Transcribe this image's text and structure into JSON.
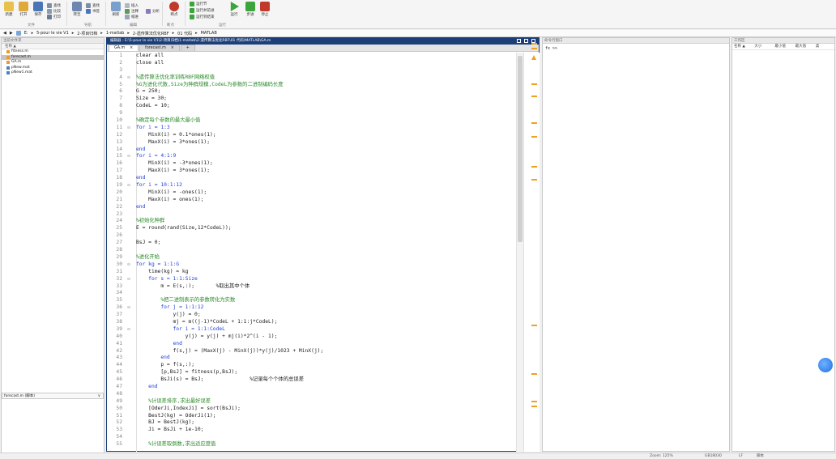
{
  "ribbon": {
    "buttons": [
      {
        "label": "新建",
        "color": "#e8c14a"
      },
      {
        "label": "打开",
        "color": "#e0a83a"
      },
      {
        "label": "保存",
        "color": "#4a76b8"
      },
      {
        "label": "查找",
        "color": "#7d8fa8"
      },
      {
        "label": "比较",
        "color": "#8a9ab4"
      },
      {
        "label": "打印",
        "color": "#6b7b90"
      },
      {
        "label": "转至",
        "color": "#6d88b0"
      },
      {
        "label": "断点",
        "color": "#c0392b"
      },
      {
        "label": "运行",
        "color": "#3aa53a"
      },
      {
        "label": "步进",
        "color": "#3aa53a"
      },
      {
        "label": "停止",
        "color": "#c0392b"
      }
    ],
    "small": [
      "插入",
      "注释",
      "缩进",
      "转至",
      "查找",
      "书签",
      "刷新",
      "运行节",
      "运行并前进",
      "运行到结束",
      "分析",
      "导航"
    ],
    "groups": [
      "文件",
      "导航",
      "编辑",
      "断点",
      "运行"
    ]
  },
  "path": {
    "items": [
      "E:",
      "5-pour le vie V1",
      "2-项目归档",
      "1-matlab",
      "2-遗传算法优化RBF",
      "01 代码",
      "MATLAB"
    ]
  },
  "left_panel": {
    "title": "当前文件夹",
    "col_header": "名称 ▲",
    "files": [
      {
        "name": "fitness.m",
        "type": "m",
        "selected": false
      },
      {
        "name": "forecast.m",
        "type": "m",
        "selected": true
      },
      {
        "name": "GA.m",
        "type": "m",
        "selected": false
      },
      {
        "name": "pNew.mat",
        "type": "mat",
        "selected": false
      },
      {
        "name": "pNew1.mat",
        "type": "mat",
        "selected": false
      }
    ],
    "details_label": "forecast.m (脚本)",
    "details_toggle": "∨"
  },
  "editor": {
    "title": "编辑器 - E:\\5-pour le vie V1\\2-项目归档\\1-matlab\\2-遗传算法优化RBF\\01 代码\\MATLAB\\GA.m",
    "tabs": [
      {
        "label": "GA.m",
        "active": true
      },
      {
        "label": "forecast.m",
        "active": false
      }
    ],
    "add_tab": "+",
    "lines": [
      {
        "n": "1",
        "code": "clear all",
        "type": "code"
      },
      {
        "n": "2",
        "code": "close all",
        "type": "code"
      },
      {
        "n": "3",
        "code": "",
        "type": "code"
      },
      {
        "n": "4",
        "code": "%遗传算法优化率训练RBF网络权值",
        "type": "cmt",
        "fold": true
      },
      {
        "n": "5",
        "code": "%G为进化代数,Size为种群规模,CodeL为参数的二进制编码长度",
        "type": "cmt"
      },
      {
        "n": "6",
        "code": "G = 250;",
        "type": "code"
      },
      {
        "n": "7",
        "code": "Size = 30;",
        "type": "code"
      },
      {
        "n": "8",
        "code": "CodeL = 10;",
        "type": "code"
      },
      {
        "n": "9",
        "code": "",
        "type": "code"
      },
      {
        "n": "10",
        "code": "%确定每个参数的最大最小值",
        "type": "cmt"
      },
      {
        "n": "11",
        "code": "for i = 1:3",
        "type": "kw",
        "fold": true
      },
      {
        "n": "12",
        "code": "    MinX(i) = 0.1*ones(1);",
        "type": "code"
      },
      {
        "n": "13",
        "code": "    MaxX(i) = 3*ones(1);",
        "type": "code"
      },
      {
        "n": "14",
        "code": "end",
        "type": "kw"
      },
      {
        "n": "15",
        "code": "for i = 4:1:9",
        "type": "kw",
        "fold": true
      },
      {
        "n": "16",
        "code": "    MinX(i) = -3*ones(1);",
        "type": "code"
      },
      {
        "n": "17",
        "code": "    MaxX(i) = 3*ones(1);",
        "type": "code"
      },
      {
        "n": "18",
        "code": "end",
        "type": "kw"
      },
      {
        "n": "19",
        "code": "for i = 10:1:12",
        "type": "kw",
        "fold": true
      },
      {
        "n": "20",
        "code": "    MinX(i) = -ones(1);",
        "type": "code"
      },
      {
        "n": "21",
        "code": "    MaxX(i) = ones(1);",
        "type": "code"
      },
      {
        "n": "22",
        "code": "end",
        "type": "kw"
      },
      {
        "n": "23",
        "code": "",
        "type": "code"
      },
      {
        "n": "24",
        "code": "%初始化种群",
        "type": "cmt"
      },
      {
        "n": "25",
        "code": "E = round(rand(Size,12*CodeL));",
        "type": "code"
      },
      {
        "n": "26",
        "code": "",
        "type": "code"
      },
      {
        "n": "27",
        "code": "BsJ = 0;",
        "type": "code"
      },
      {
        "n": "28",
        "code": "",
        "type": "code"
      },
      {
        "n": "29",
        "code": "%进化开始",
        "type": "cmt"
      },
      {
        "n": "30",
        "code": "for kg = 1:1:G",
        "type": "kw",
        "fold": true
      },
      {
        "n": "31",
        "code": "    time(kg) = kg",
        "type": "code"
      },
      {
        "n": "32",
        "code": "    for s = 1:1:Size",
        "type": "kw",
        "fold": true
      },
      {
        "n": "33",
        "code": "        m = E(s,:);       %取出其中个体",
        "type": "code"
      },
      {
        "n": "34",
        "code": "",
        "type": "code"
      },
      {
        "n": "35",
        "code": "        %把二进制表示的参数转化为实数",
        "type": "cmt"
      },
      {
        "n": "36",
        "code": "        for j = 1:1:12",
        "type": "kw",
        "fold": true
      },
      {
        "n": "37",
        "code": "            y(j) = 0;",
        "type": "code"
      },
      {
        "n": "38",
        "code": "            mj = m((j-1)*CodeL + 1:1:j*CodeL);",
        "type": "code"
      },
      {
        "n": "39",
        "code": "            for i = 1:1:CodeL",
        "type": "kw",
        "fold": true
      },
      {
        "n": "40",
        "code": "                y(j) = y(j) + mj(i)*2^(i - 1);",
        "type": "code"
      },
      {
        "n": "41",
        "code": "            end",
        "type": "kw"
      },
      {
        "n": "42",
        "code": "            f(s,j) = (MaxX(j) - MinX(j))*y(j)/1023 + MinX(j);",
        "type": "code"
      },
      {
        "n": "43",
        "code": "        end",
        "type": "kw"
      },
      {
        "n": "44",
        "code": "        p = f(s,:);",
        "type": "code"
      },
      {
        "n": "45",
        "code": "        [p,BsJ] = fitness(p,BsJ);",
        "type": "code"
      },
      {
        "n": "46",
        "code": "        BsJi(s) = BsJ;               %记录每个个体的总误差",
        "type": "code"
      },
      {
        "n": "47",
        "code": "    end",
        "type": "kw"
      },
      {
        "n": "48",
        "code": "",
        "type": "code"
      },
      {
        "n": "49",
        "code": "    %计误差排序,求出最好误差",
        "type": "cmt"
      },
      {
        "n": "50",
        "code": "    [OderJi,IndexJi] = sort(BsJi);",
        "type": "code"
      },
      {
        "n": "51",
        "code": "    BestJ(kg) = OderJi(1);",
        "type": "code"
      },
      {
        "n": "52",
        "code": "    BJ = BestJ(kg);",
        "type": "code"
      },
      {
        "n": "53",
        "code": "    Ji = BsJi + 1e-10;",
        "type": "code"
      },
      {
        "n": "54",
        "code": "",
        "type": "code"
      },
      {
        "n": "55",
        "code": "    %计误差取倒数,求出适应度值",
        "type": "cmt"
      }
    ]
  },
  "command_window": {
    "title": "命令行窗口",
    "prompt": "fx >>"
  },
  "workspace": {
    "title": "工作区",
    "columns": [
      "名称 ▲",
      "大小",
      "最小值",
      "最大值",
      "类"
    ]
  },
  "status": {
    "zoom": "Zoom: 125%",
    "encoding": "GB18030",
    "eol": "LF",
    "kind": "脚本"
  }
}
